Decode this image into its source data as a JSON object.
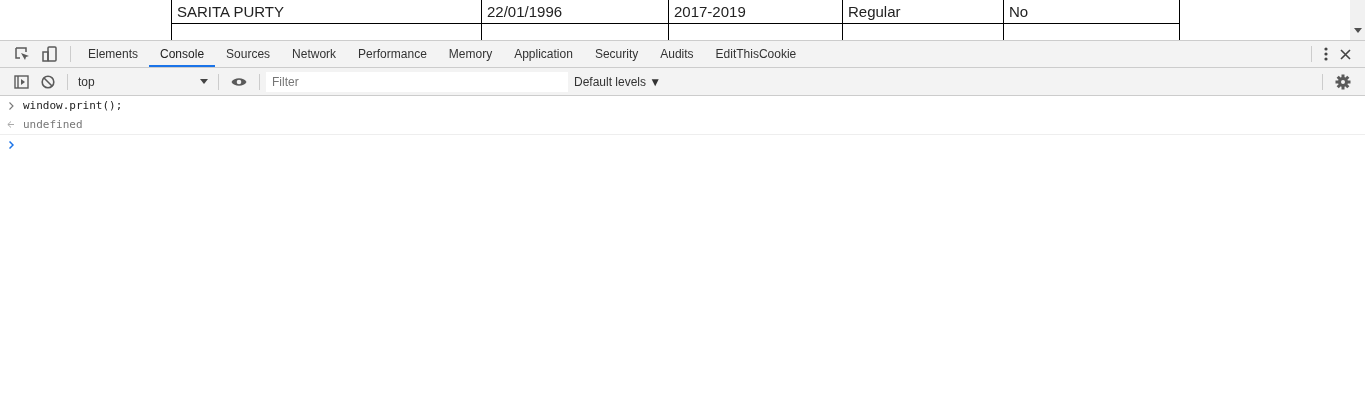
{
  "page_table": {
    "rows": [
      [
        "SARITA PURTY",
        "22/01/1996",
        "2017-2019",
        "Regular",
        "No"
      ]
    ]
  },
  "devtools": {
    "tabs": [
      {
        "label": "Elements",
        "selected": false
      },
      {
        "label": "Console",
        "selected": true
      },
      {
        "label": "Sources",
        "selected": false
      },
      {
        "label": "Network",
        "selected": false
      },
      {
        "label": "Performance",
        "selected": false
      },
      {
        "label": "Memory",
        "selected": false
      },
      {
        "label": "Application",
        "selected": false
      },
      {
        "label": "Security",
        "selected": false
      },
      {
        "label": "Audits",
        "selected": false
      },
      {
        "label": "EditThisCookie",
        "selected": false
      }
    ],
    "context": "top",
    "filter_placeholder": "Filter",
    "levels": "Default levels ▼",
    "console": [
      {
        "kind": "input",
        "text": "window.print();"
      },
      {
        "kind": "result",
        "text": "undefined"
      }
    ]
  }
}
